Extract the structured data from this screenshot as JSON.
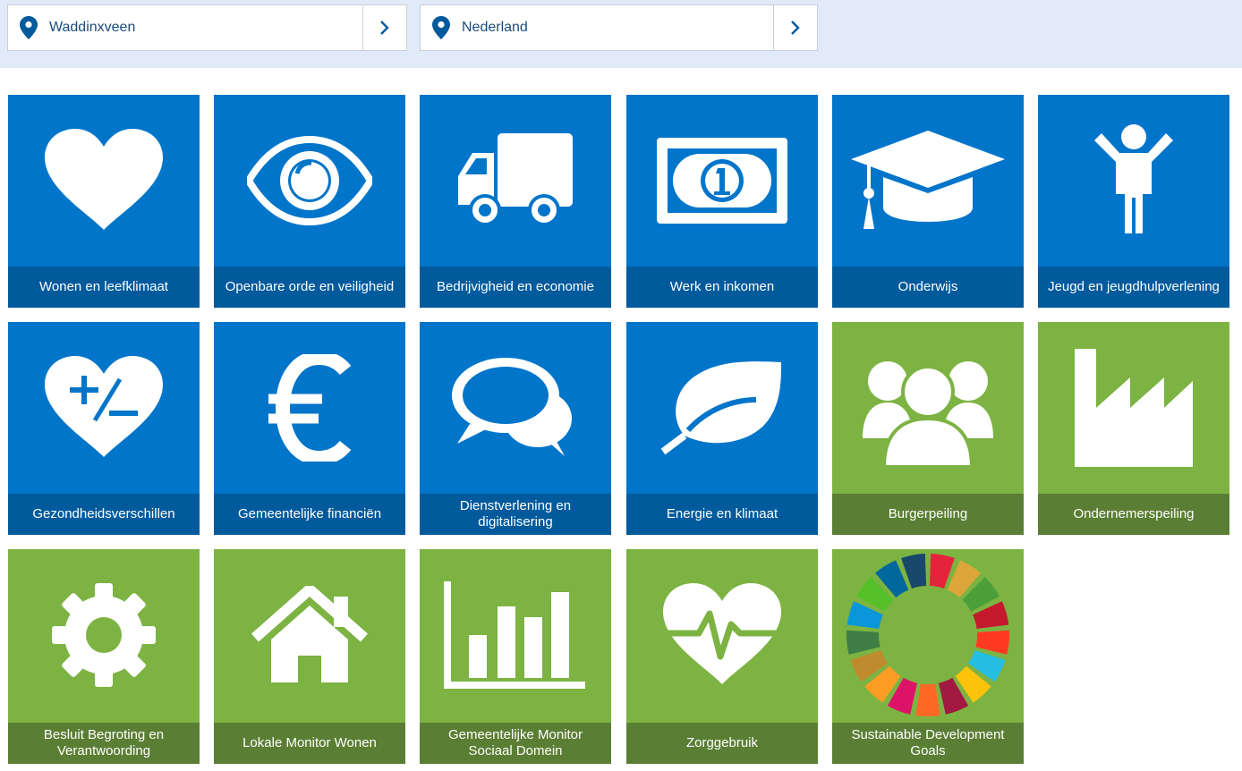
{
  "locations": [
    {
      "name": "Waddinxveen",
      "icon": "location-pin-icon",
      "action_icon": "chevron-right-icon"
    },
    {
      "name": "Nederland",
      "icon": "location-pin-icon",
      "action_icon": "chevron-right-icon"
    }
  ],
  "colors": {
    "tile_blue": "#0075c9",
    "tile_blue_label": "#005a9c",
    "tile_green": "#7cb342",
    "tile_green_label": "#5a7f34",
    "topbar": "#e1eaf8"
  },
  "tiles": [
    {
      "label": "Wonen en leefklimaat",
      "icon": "heart-icon"
    },
    {
      "label": "Openbare orde en veiligheid",
      "icon": "eye-icon"
    },
    {
      "label": "Bedrijvigheid en economie",
      "icon": "truck-icon"
    },
    {
      "label": "Werk en inkomen",
      "icon": "banknote-icon"
    },
    {
      "label": "Onderwijs",
      "icon": "graduation-cap-icon"
    },
    {
      "label": "Jeugd en jeugdhulpverlening",
      "icon": "child-icon"
    },
    {
      "label": "Gezondheidsverschillen",
      "icon": "heart-plus-minus-icon"
    },
    {
      "label": "Gemeentelijke financiën",
      "icon": "euro-icon"
    },
    {
      "label": "Dienstverlening en digitalisering",
      "icon": "speech-bubbles-icon"
    },
    {
      "label": "Energie en klimaat",
      "icon": "leaf-icon"
    },
    {
      "label": "Burgerpeiling",
      "icon": "people-group-icon"
    },
    {
      "label": "Ondernemerspeiling",
      "icon": "factory-icon"
    },
    {
      "label": "Besluit Begroting en Verantwoording",
      "icon": "gear-icon"
    },
    {
      "label": "Lokale Monitor Wonen",
      "icon": "house-icon"
    },
    {
      "label": "Gemeentelijke Monitor Sociaal Domein",
      "icon": "bar-chart-icon"
    },
    {
      "label": "Zorggebruik",
      "icon": "heart-pulse-icon"
    },
    {
      "label": "Sustainable Development Goals",
      "icon": "sdg-wheel-icon"
    }
  ]
}
